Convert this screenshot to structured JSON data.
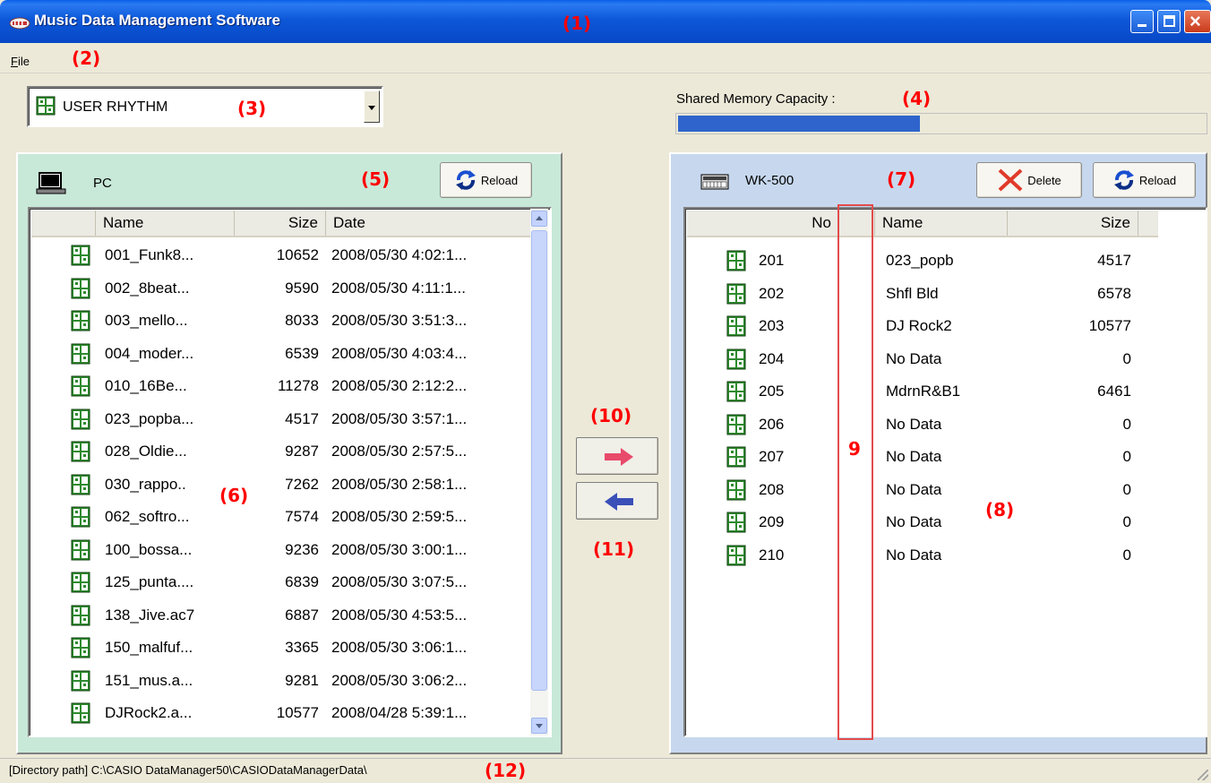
{
  "window": {
    "title": "Music Data Management Software"
  },
  "menu": {
    "file_first": "F",
    "file_rest": "ile"
  },
  "toolbar": {
    "category_selected": "USER RHYTHM",
    "shared_memory_label": "Shared Memory Capacity :",
    "shared_memory_fraction": 0.46
  },
  "pc_panel": {
    "label": "PC",
    "reload_label": "Reload",
    "columns": [
      "Name",
      "Size",
      "Date"
    ],
    "files": [
      {
        "name": "001_Funk8...",
        "size": "10652",
        "date": "2008/05/30 4:02:1..."
      },
      {
        "name": "002_8beat...",
        "size": "9590",
        "date": "2008/05/30 4:11:1..."
      },
      {
        "name": "003_mello...",
        "size": "8033",
        "date": "2008/05/30 3:51:3..."
      },
      {
        "name": "004_moder...",
        "size": "6539",
        "date": "2008/05/30 4:03:4..."
      },
      {
        "name": "010_16Be...",
        "size": "11278",
        "date": "2008/05/30 2:12:2..."
      },
      {
        "name": "023_popba...",
        "size": "4517",
        "date": "2008/05/30 3:57:1..."
      },
      {
        "name": "028_Oldie...",
        "size": "9287",
        "date": "2008/05/30 2:57:5..."
      },
      {
        "name": "030_rappo..",
        "size": "7262",
        "date": "2008/05/30 2:58:1..."
      },
      {
        "name": "062_softro...",
        "size": "7574",
        "date": "2008/05/30 2:59:5..."
      },
      {
        "name": "100_bossa...",
        "size": "9236",
        "date": "2008/05/30 3:00:1..."
      },
      {
        "name": "125_punta....",
        "size": "6839",
        "date": "2008/05/30 3:07:5..."
      },
      {
        "name": "138_Jive.ac7",
        "size": "6887",
        "date": "2008/05/30 4:53:5..."
      },
      {
        "name": "150_malfuf...",
        "size": "3365",
        "date": "2008/05/30 3:06:1..."
      },
      {
        "name": "151_mus.a...",
        "size": "9281",
        "date": "2008/05/30 3:06:2..."
      },
      {
        "name": "DJRock2.a...",
        "size": "10577",
        "date": "2008/04/28 5:39:1..."
      }
    ]
  },
  "device_panel": {
    "label": "WK-500",
    "delete_label": "Delete",
    "reload_label": "Reload",
    "columns": [
      "No",
      "",
      "Name",
      "Size"
    ],
    "items": [
      {
        "no": "201",
        "name": "023_popb",
        "size": "4517"
      },
      {
        "no": "202",
        "name": "Shfl Bld",
        "size": "6578"
      },
      {
        "no": "203",
        "name": "DJ Rock2",
        "size": "10577"
      },
      {
        "no": "204",
        "name": "No Data",
        "size": "0"
      },
      {
        "no": "205",
        "name": "MdrnR&B1",
        "size": "6461"
      },
      {
        "no": "206",
        "name": "No Data",
        "size": "0"
      },
      {
        "no": "207",
        "name": "No Data",
        "size": "0"
      },
      {
        "no": "208",
        "name": "No Data",
        "size": "0"
      },
      {
        "no": "209",
        "name": "No Data",
        "size": "0"
      },
      {
        "no": "210",
        "name": "No Data",
        "size": "0"
      }
    ]
  },
  "status": {
    "path": "[Directory path] C:\\CASIO DataManager50\\CASIODataManagerData\\"
  },
  "annotations": {
    "a1": "(1)",
    "a2": "(2)",
    "a3": "(3)",
    "a4": "(4)",
    "a5": "(5)",
    "a6": "(6)",
    "a7": "(7)",
    "a8": "(8)",
    "a9": "9",
    "a10": "(10)",
    "a11": "(11)",
    "a12": "(12)"
  },
  "colors": {
    "title_bar": "#0c57d8",
    "pc_panel_bg": "#c8e9d8",
    "device_panel_bg": "#c7d8ee",
    "memory_fill": "#2f64cc",
    "annotation": "#ff0000"
  },
  "icons": {
    "app": "keyboard-app-icon",
    "file": "rhythm-file-icon",
    "pc": "computer-icon",
    "device": "keyboard-device-icon",
    "reload": "reload-arrows-icon",
    "delete": "delete-x-icon",
    "send": "arrow-right-icon",
    "receive": "arrow-left-icon"
  }
}
